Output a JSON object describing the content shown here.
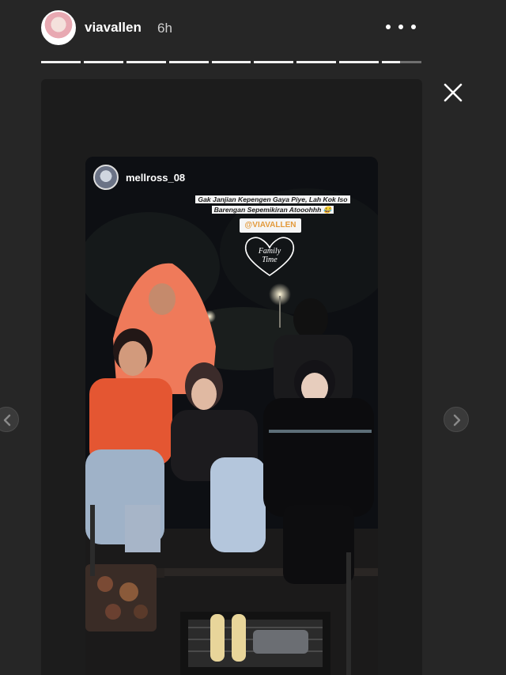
{
  "header": {
    "username": "viavallen",
    "time": "6h",
    "avatar_icon": "user-avatar-icon",
    "more_icon": "more-options-icon"
  },
  "progress": {
    "segments": 9,
    "current_index": 8,
    "current_fraction": 0.45
  },
  "close_icon": "close-icon",
  "post": {
    "username": "mellross_08",
    "caption": "Gak Janjian Kepengen Gaya Piye, Lah Kok Iso Barengan Sepemikiran Atooohhh 😂",
    "mention": "@VIAVALLEN",
    "sticker_text": "Family Time"
  },
  "nav": {
    "prev_icon": "chevron-left-icon",
    "next_icon": "chevron-right-icon"
  },
  "colors": {
    "background": "#262626",
    "mention_text": "#e39a3b"
  }
}
